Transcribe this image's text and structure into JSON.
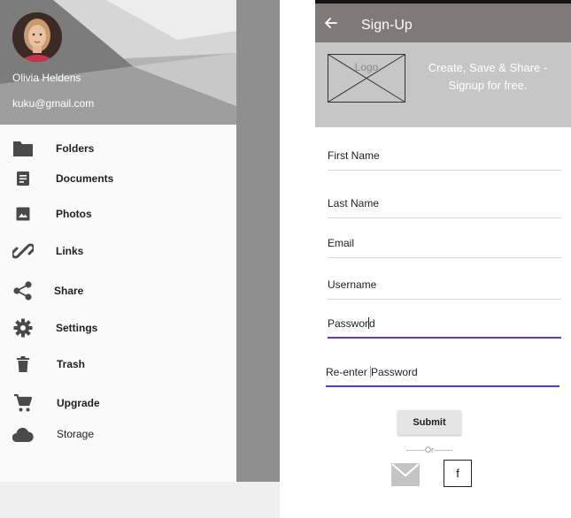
{
  "drawer": {
    "profile": {
      "name": "Olivia Heldens",
      "email": "kuku@gmail.com"
    },
    "items": [
      {
        "label": "Folders",
        "icon": "folder-icon"
      },
      {
        "label": "Documents",
        "icon": "document-icon"
      },
      {
        "label": "Photos",
        "icon": "image-icon"
      },
      {
        "label": "Links",
        "icon": "link-icon"
      },
      {
        "label": "Share",
        "icon": "share-icon"
      },
      {
        "label": "Settings",
        "icon": "gear-icon"
      },
      {
        "label": "Trash",
        "icon": "trash-icon"
      },
      {
        "label": "Upgrade",
        "icon": "cart-icon"
      },
      {
        "label": "Storage",
        "icon": "cloud-icon"
      }
    ]
  },
  "signup": {
    "title": "Sign-Up",
    "logo_text": "Logo",
    "banner_text": "Create, Save & Share  - Signup for free.",
    "fields": {
      "first_name": "First Name",
      "last_name": "Last Name",
      "email": "Email",
      "username": "Username",
      "password_before_caret": "Passwor",
      "password_after_caret": "d",
      "reenter_before_caret": "Re-enter ",
      "reenter_after_caret": "Password"
    },
    "submit_label": "Submit",
    "or_separator": "-------Or-------",
    "facebook_label": "f"
  },
  "colors": {
    "app_bar": "#7f7a78",
    "banner": "#c6c6c6",
    "active_underline": "#5a3fb8",
    "drawer_header": "#8a8a8a",
    "icon": "#4a4a4a"
  }
}
